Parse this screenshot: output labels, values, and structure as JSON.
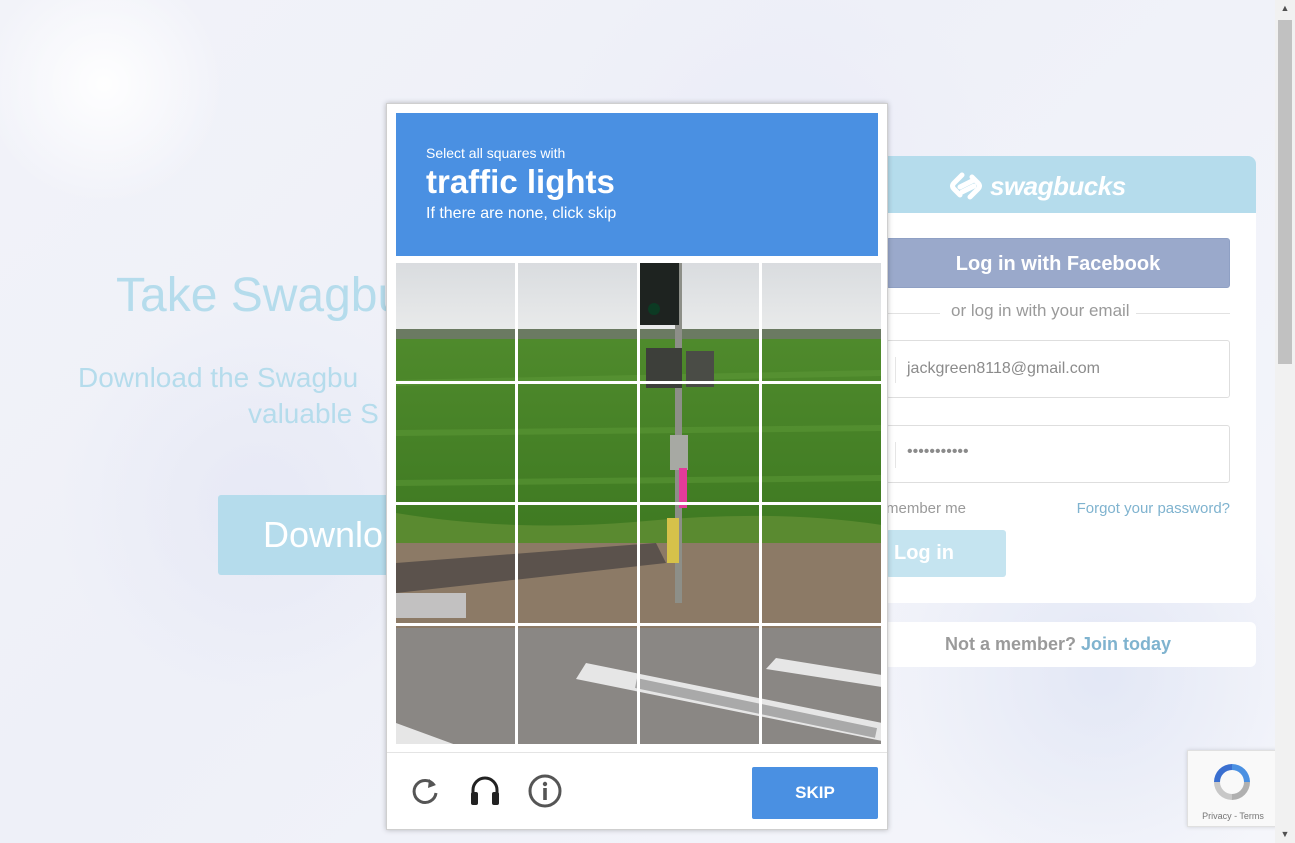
{
  "background": {
    "hero_title": "Take Swagbu",
    "hero_sub_line1": "Download the Swagbu",
    "hero_sub_line2": "valuable S",
    "hero_button": "Downlo"
  },
  "login": {
    "logo_text": "swagbucks",
    "facebook_button": "Log in with Facebook",
    "or_text": "or log in with your email",
    "email_value": "jackgreen8118@gmail.com",
    "password_value": "•••••••••••",
    "remember_label": "member me",
    "forgot_link": "Forgot your password?",
    "login_button": "Log in",
    "not_member": "Not a member?",
    "join_link": "Join today"
  },
  "captcha": {
    "instruction_small": "Select all squares with",
    "target": "traffic lights",
    "hint": "If there are none, click skip",
    "grid_rows": 4,
    "grid_cols": 4,
    "skip_button": "SKIP",
    "footer_icons": [
      "reload-icon",
      "audio-icon",
      "info-icon"
    ]
  },
  "recaptcha_badge": {
    "text": "Privacy - Terms"
  },
  "colors": {
    "brand_light_blue": "#b5dcec",
    "captcha_blue": "#4a90e2",
    "facebook_muted": "#9aa9cb",
    "link_blue": "#7fb3cf"
  }
}
